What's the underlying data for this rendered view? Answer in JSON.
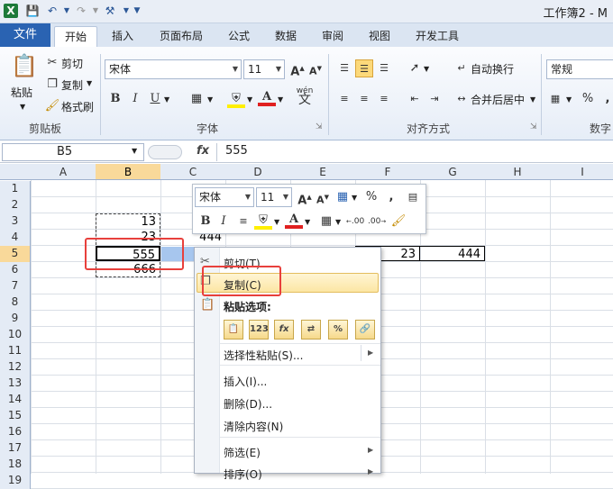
{
  "window": {
    "title": "工作簿2 - M"
  },
  "tabs": [
    "文件",
    "开始",
    "插入",
    "页面布局",
    "公式",
    "数据",
    "审阅",
    "视图",
    "开发工具"
  ],
  "ribbon": {
    "clipboard": {
      "paste": "粘贴",
      "cut": "剪切",
      "copy": "复制",
      "format_painter": "格式刷",
      "label": "剪贴板"
    },
    "font": {
      "name": "宋体",
      "size": "11",
      "label": "字体",
      "bold": "B",
      "italic": "I",
      "underline": "U",
      "color_a": "A",
      "wen": "wén"
    },
    "alignment": {
      "wrap": "自动换行",
      "merge": "合并后居中",
      "label": "对齐方式"
    },
    "number": {
      "format": "常规",
      "percent": "%",
      "label": "数字"
    }
  },
  "formula_bar": {
    "name_box": "B5",
    "fx": "fx",
    "value": "555"
  },
  "columns": [
    "A",
    "B",
    "C",
    "D",
    "E",
    "F",
    "G",
    "H",
    "I"
  ],
  "rows": [
    "1",
    "2",
    "3",
    "4",
    "5",
    "6",
    "7",
    "8",
    "9",
    "10",
    "11",
    "12",
    "13",
    "14",
    "15",
    "16",
    "17",
    "18",
    "19"
  ],
  "cells": {
    "B3": "13",
    "B4": "23",
    "C4": "444",
    "B5": "555",
    "B6": "666",
    "F5": "23",
    "G5": "444"
  },
  "mini_toolbar": {
    "font": "宋体",
    "size": "11",
    "percent": "%",
    "comma": ",",
    "bold": "B",
    "italic": "I",
    "color_a": "A",
    "dec_inc": ".00",
    "dec_dec": ".00"
  },
  "context_menu": {
    "cut": "剪切(T)",
    "copy": "复制(C)",
    "paste_options": "粘贴选项:",
    "paste_icons": [
      "",
      "123",
      "fx",
      "",
      "%",
      ""
    ],
    "paste_special": "选择性粘贴(S)...",
    "insert": "插入(I)...",
    "delete": "删除(D)...",
    "clear": "清除内容(N)",
    "filter": "筛选(E)",
    "sort": "排序(O)"
  },
  "colors": {
    "file_tab": "#2a63b2",
    "selection": "#f9d99a",
    "highlight_box": "#e8403c"
  }
}
